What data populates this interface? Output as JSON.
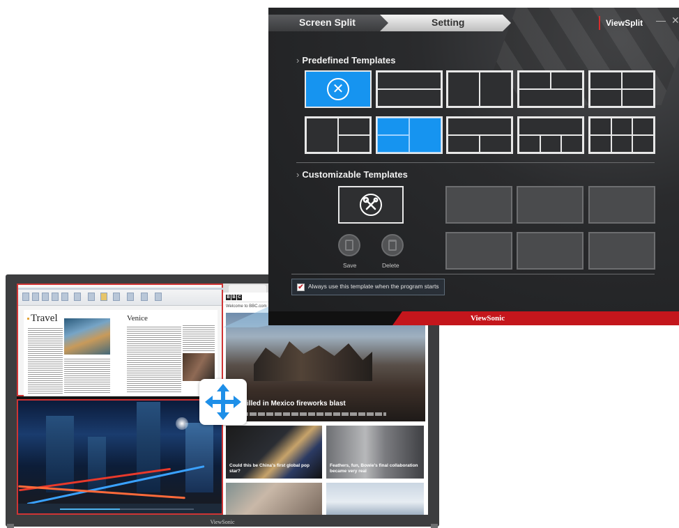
{
  "window": {
    "tabs": [
      {
        "label": "Screen Split",
        "active": false
      },
      {
        "label": "Setting",
        "active": true
      }
    ],
    "brand": "ViewSplit",
    "minimize_glyph": "—",
    "close_glyph": "✕"
  },
  "predefined": {
    "title": "Predefined Templates",
    "selected_index": 6,
    "templates_count": 10
  },
  "customizable": {
    "title": "Customizable Templates",
    "save_label": "Save",
    "delete_label": "Delete",
    "slots_count": 6
  },
  "startup_option": {
    "label": "Always use this template when the program starts",
    "checked": true
  },
  "footer": {
    "logo": "ViewSonic"
  },
  "display": {
    "bezel_logo": "ViewSonic",
    "doc": {
      "title_left": "Travel",
      "title_right": "Venice"
    },
    "browser": {
      "welcome": "Welcome to BBC.com",
      "headline": "ns killed in Mexico fireworks blast",
      "tiles": [
        "Could this be China's first global pop star?",
        "Feathers, fun, Bowie's final collaboration became very real"
      ]
    }
  },
  "colors": {
    "accent": "#1694f0",
    "brand_red": "#c4161c",
    "checkbox_mark": "#c0262d"
  },
  "icons": [
    "cancel-icon",
    "tools-icon",
    "save-icon",
    "trash-icon",
    "move-arrows-icon",
    "checkmark-icon"
  ]
}
